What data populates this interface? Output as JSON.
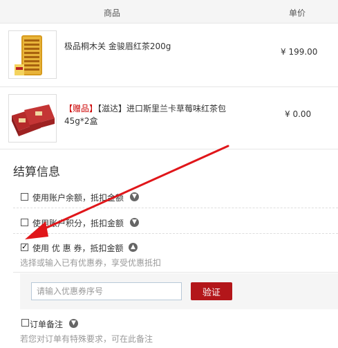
{
  "table": {
    "col_product": "商品",
    "col_price": "单价"
  },
  "products": [
    {
      "name": "极品桐木关 金骏眉红茶200g",
      "gift_tag": "",
      "price": "¥ 199.00"
    },
    {
      "name": "【滋达】进口斯里兰卡草莓味红茶包 45g*2盒",
      "gift_tag": "【赠品】",
      "price": "¥ 0.00"
    }
  ],
  "checkout": {
    "title": "结算信息",
    "balance_label": "使用账户余额，抵扣金额",
    "points_label": "使用账户积分，抵扣金额",
    "coupon_label": "使用 优 惠 券，抵扣金额",
    "coupon_hint": "选择或输入已有优惠券，享受优惠抵扣",
    "coupon_placeholder": "请输入优惠券序号",
    "verify_label": "验证",
    "remark_label": "订单备注",
    "remark_hint": "若您对订单有特殊要求，可在此备注"
  },
  "state": {
    "balance_checked": false,
    "points_checked": false,
    "coupon_checked": true,
    "remark_checked": false
  },
  "colors": {
    "accent": "#b3161a",
    "arrow": "#e0161a"
  }
}
